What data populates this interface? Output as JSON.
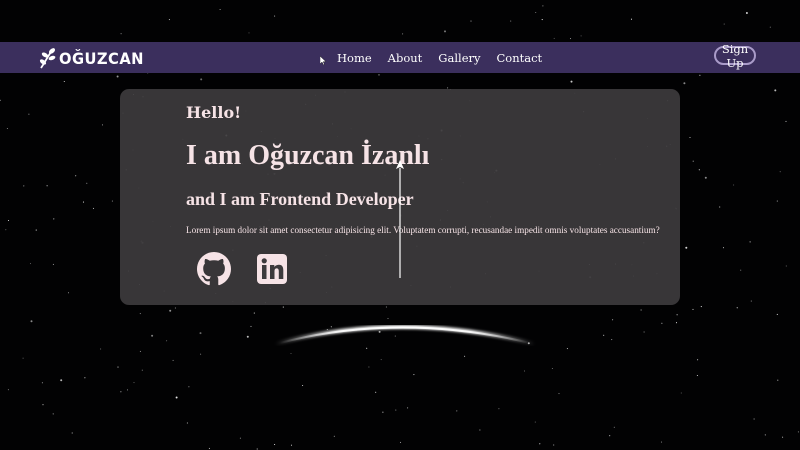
{
  "nav": {
    "logo_text": "OĞUZCAN",
    "links": [
      "Home",
      "About",
      "Gallery",
      "Contact"
    ],
    "signup_label": "Sign Up"
  },
  "hero": {
    "greeting": "Hello!",
    "name": "I am Oğuzcan İzanlı",
    "role": "and I am Frontend Developer",
    "description": "Lorem ipsum dolor sit amet consectetur adipisicing elit. Voluptatem corrupti, recusandae impedit omnis voluptates accusantium?"
  },
  "socials": [
    {
      "icon": "github-icon"
    },
    {
      "icon": "linkedin-icon"
    }
  ],
  "colors": {
    "navbar_bg": "#3b2f5d",
    "card_bg": "#3c3a3c",
    "text_pink": "#f6e3e6",
    "signup_border": "#a99bc9",
    "space_bg": "#020203"
  }
}
